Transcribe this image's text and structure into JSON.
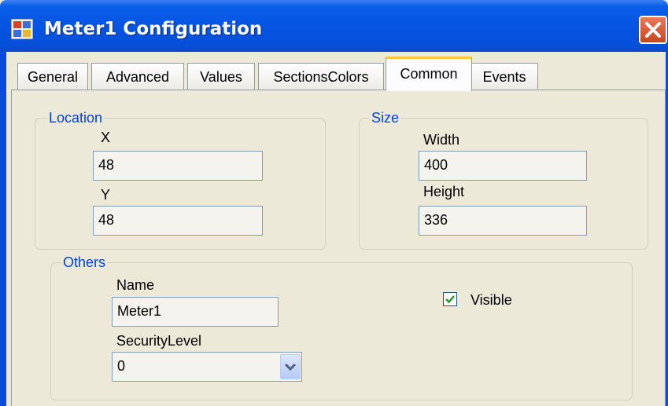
{
  "window": {
    "title": "Meter1 Configuration"
  },
  "tabs": [
    {
      "label": "General"
    },
    {
      "label": "Advanced"
    },
    {
      "label": "Values"
    },
    {
      "label": "SectionsColors"
    },
    {
      "label": "Common"
    },
    {
      "label": "Events"
    }
  ],
  "active_tab": "Common",
  "location": {
    "legend": "Location",
    "x_label": "X",
    "x_value": "48",
    "y_label": "Y",
    "y_value": "48"
  },
  "size": {
    "legend": "Size",
    "width_label": "Width",
    "width_value": "400",
    "height_label": "Height",
    "height_value": "336"
  },
  "others": {
    "legend": "Others",
    "name_label": "Name",
    "name_value": "Meter1",
    "security_label": "SecurityLevel",
    "security_value": "0",
    "visible_label": "Visible",
    "visible_checked": true
  },
  "colors": {
    "title_bar": "#0554E3",
    "legend_text": "#0046D5",
    "active_tab_accent": "#FFC83C",
    "close_button": "#C8451E"
  },
  "icons": {
    "app": "window-app-icon",
    "close": "close-icon",
    "checkbox": "checkmark-icon",
    "dropdown": "chevron-down-icon"
  }
}
